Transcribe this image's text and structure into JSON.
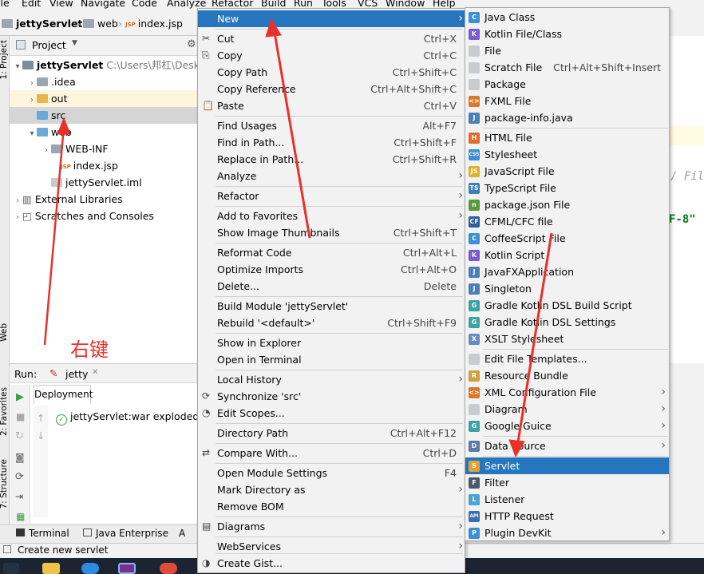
{
  "menubar": [
    "ile",
    "Edit",
    "View",
    "Navigate",
    "Code",
    "Analyze",
    "Refactor",
    "Build",
    "Run",
    "Tools",
    "VCS",
    "Window",
    "Help"
  ],
  "breadcrumbs": [
    "jettyServlet",
    "web",
    "index.jsp"
  ],
  "project": {
    "title": "Project",
    "tree": [
      {
        "label": "jettyServlet",
        "extra": "C:\\Users\\邦杠\\Deskto"
      },
      {
        "label": ".idea"
      },
      {
        "label": "out"
      },
      {
        "label": "src"
      },
      {
        "label": "web"
      },
      {
        "label": "WEB-INF"
      },
      {
        "label": "index.jsp"
      },
      {
        "label": "jettyServlet.iml"
      },
      {
        "label": "External Libraries"
      },
      {
        "label": "Scratches and Consoles"
      }
    ]
  },
  "sidebar_tabs": [
    "1: Project",
    "Web",
    "2: Favorites",
    "7: Structure"
  ],
  "annotation": "右键",
  "run": {
    "label": "Run:",
    "config": "jetty",
    "tab": "Deployment",
    "entry": "jettyServlet:war exploded"
  },
  "bottom_tools": [
    "Terminal",
    "Java Enterprise",
    "A"
  ],
  "status": "Create new servlet",
  "editor_fragments": [
    "/ Fil",
    "F-8\""
  ],
  "context_menu": [
    {
      "label": "New",
      "shortcut": "",
      "submenu": true
    },
    {
      "label": "Cut",
      "shortcut": "Ctrl+X"
    },
    {
      "label": "Copy",
      "shortcut": "Ctrl+C"
    },
    {
      "label": "Copy Path",
      "shortcut": "Ctrl+Shift+C"
    },
    {
      "label": "Copy Reference",
      "shortcut": "Ctrl+Alt+Shift+C"
    },
    {
      "label": "Paste",
      "shortcut": "Ctrl+V"
    },
    {
      "label": "Find Usages",
      "shortcut": "Alt+F7"
    },
    {
      "label": "Find in Path...",
      "shortcut": "Ctrl+Shift+F"
    },
    {
      "label": "Replace in Path...",
      "shortcut": "Ctrl+Shift+R"
    },
    {
      "label": "Analyze",
      "shortcut": "",
      "submenu": true
    },
    {
      "label": "Refactor",
      "shortcut": "",
      "submenu": true
    },
    {
      "label": "Add to Favorites",
      "shortcut": "",
      "submenu": true
    },
    {
      "label": "Show Image Thumbnails",
      "shortcut": "Ctrl+Shift+T"
    },
    {
      "label": "Reformat Code",
      "shortcut": "Ctrl+Alt+L"
    },
    {
      "label": "Optimize Imports",
      "shortcut": "Ctrl+Alt+O"
    },
    {
      "label": "Delete...",
      "shortcut": "Delete"
    },
    {
      "label": "Build Module 'jettyServlet'",
      "shortcut": ""
    },
    {
      "label": "Rebuild '<default>'",
      "shortcut": "Ctrl+Shift+F9"
    },
    {
      "label": "Show in Explorer",
      "shortcut": ""
    },
    {
      "label": "Open in Terminal",
      "shortcut": ""
    },
    {
      "label": "Local History",
      "shortcut": "",
      "submenu": true
    },
    {
      "label": "Synchronize 'src'",
      "shortcut": ""
    },
    {
      "label": "Edit Scopes...",
      "shortcut": ""
    },
    {
      "label": "Directory Path",
      "shortcut": "Ctrl+Alt+F12"
    },
    {
      "label": "Compare With...",
      "shortcut": "Ctrl+D"
    },
    {
      "label": "Open Module Settings",
      "shortcut": "F4"
    },
    {
      "label": "Mark Directory as",
      "shortcut": "",
      "submenu": true
    },
    {
      "label": "Remove BOM",
      "shortcut": ""
    },
    {
      "label": "Diagrams",
      "shortcut": "",
      "submenu": true
    },
    {
      "label": "WebServices",
      "shortcut": "",
      "submenu": true
    },
    {
      "label": "Create Gist...",
      "shortcut": ""
    }
  ],
  "new_menu": [
    {
      "label": "Java Class",
      "shortcut": "",
      "icon": "C"
    },
    {
      "label": "Kotlin File/Class",
      "shortcut": "",
      "icon": "K"
    },
    {
      "label": "File",
      "shortcut": "",
      "icon": ""
    },
    {
      "label": "Scratch File",
      "shortcut": "Ctrl+Alt+Shift+Insert",
      "icon": ""
    },
    {
      "label": "Package",
      "shortcut": "",
      "icon": ""
    },
    {
      "label": "FXML File",
      "shortcut": "",
      "icon": "<>"
    },
    {
      "label": "package-info.java",
      "shortcut": "",
      "icon": "J"
    },
    {
      "label": "HTML File",
      "shortcut": "",
      "icon": "H"
    },
    {
      "label": "Stylesheet",
      "shortcut": "",
      "icon": "CSS"
    },
    {
      "label": "JavaScript File",
      "shortcut": "",
      "icon": "JS"
    },
    {
      "label": "TypeScript File",
      "shortcut": "",
      "icon": "TS"
    },
    {
      "label": "package.json File",
      "shortcut": "",
      "icon": "n"
    },
    {
      "label": "CFML/CFC file",
      "shortcut": "",
      "icon": "CF"
    },
    {
      "label": "CoffeeScript File",
      "shortcut": "",
      "icon": "C"
    },
    {
      "label": "Kotlin Script",
      "shortcut": "",
      "icon": "K"
    },
    {
      "label": "JavaFXApplication",
      "shortcut": "",
      "icon": "J"
    },
    {
      "label": "Singleton",
      "shortcut": "",
      "icon": "J"
    },
    {
      "label": "Gradle Kotlin DSL Build Script",
      "shortcut": "",
      "icon": "G"
    },
    {
      "label": "Gradle Kotlin DSL Settings",
      "shortcut": "",
      "icon": "G"
    },
    {
      "label": "XSLT Stylesheet",
      "shortcut": "",
      "icon": "X"
    },
    {
      "label": "Edit File Templates...",
      "shortcut": "",
      "icon": ""
    },
    {
      "label": "Resource Bundle",
      "shortcut": "",
      "icon": "R"
    },
    {
      "label": "XML Configuration File",
      "shortcut": "",
      "icon": "<>",
      "submenu": true
    },
    {
      "label": "Diagram",
      "shortcut": "",
      "icon": "",
      "submenu": true
    },
    {
      "label": "Google Guice",
      "shortcut": "",
      "icon": "G",
      "submenu": true
    },
    {
      "label": "Data Source",
      "shortcut": "",
      "icon": "D",
      "submenu": true
    },
    {
      "label": "Servlet",
      "shortcut": "",
      "icon": "S"
    },
    {
      "label": "Filter",
      "shortcut": "",
      "icon": "F"
    },
    {
      "label": "Listener",
      "shortcut": "",
      "icon": "L"
    },
    {
      "label": "HTTP Request",
      "shortcut": "",
      "icon": "API"
    },
    {
      "label": "Plugin DevKit",
      "shortcut": "",
      "icon": "P",
      "submenu": true
    }
  ],
  "colors": {
    "accent": "#2675bf",
    "annotation": "#e8312a"
  }
}
